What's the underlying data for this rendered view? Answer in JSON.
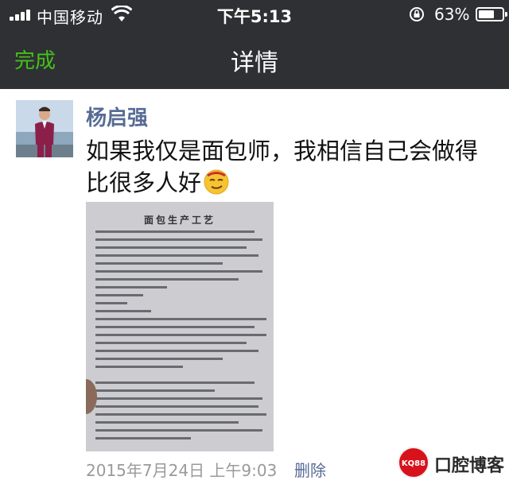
{
  "status_bar": {
    "carrier": "中国移动",
    "time": "下午5:13",
    "battery": "63%",
    "battery_level": 0.63
  },
  "navbar": {
    "back_label": "完成",
    "title": "详情"
  },
  "post": {
    "username": "杨启强",
    "text": "如果我仅是面包师，我相信自己会做得比很多人好",
    "emoji": "smirk-face-emoji",
    "photo": {
      "doc_title": "面包生产工艺"
    },
    "timestamp": "2015年7月24日 上午9:03",
    "delete_label": "删除"
  },
  "watermark": {
    "badge": "KQ88",
    "text": "口腔博客"
  },
  "colors": {
    "header_bg": "#2e3033",
    "accent_green": "#45c01a",
    "link_blue": "#576b95",
    "muted_gray": "#9a9a9a"
  }
}
